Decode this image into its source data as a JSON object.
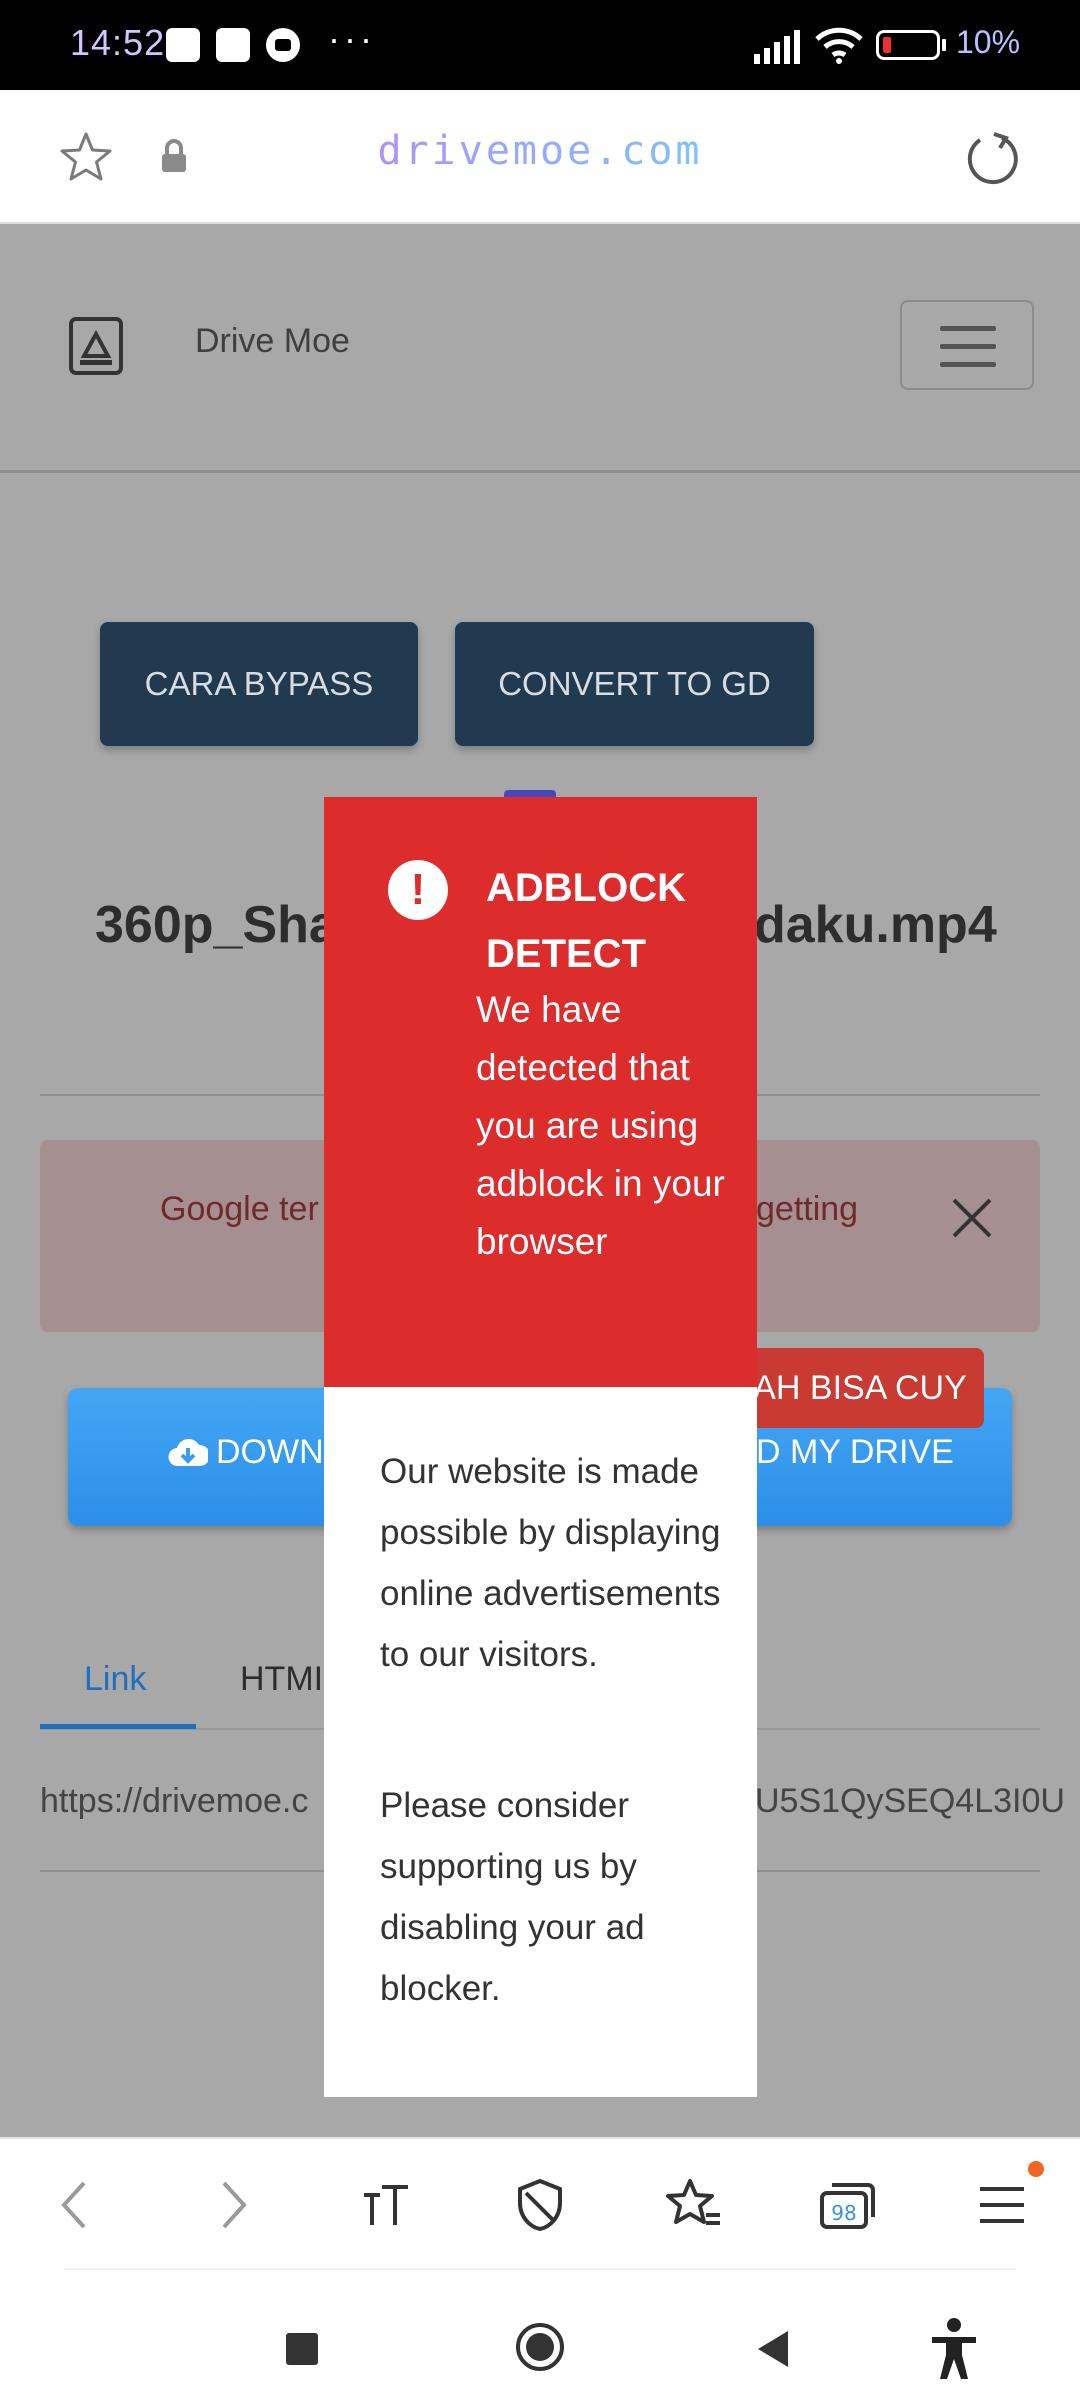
{
  "status_bar": {
    "time": "14:52",
    "more": "···",
    "battery": "10%"
  },
  "browser": {
    "url": "drivemoe.com"
  },
  "site": {
    "brand": "Drive Moe",
    "buttons": {
      "bypass": "CARA BYPASS",
      "convert": "CONVERT TO GD"
    },
    "file_title": "360p_Sha",
    "file_title_tail": "daku.mp4",
    "alert_left": "Google ter",
    "alert_right": "getting",
    "download_left": "DOWN",
    "download_right": "D MY DRIVE",
    "badge": "AH BISA CUY",
    "tabs": {
      "link": "Link",
      "html": "HTMI"
    },
    "link_left": "https://drivemoe.c",
    "link_right": "U5S1QySEQ4L3I0U"
  },
  "modal": {
    "title": "ADBLOCK DETECT",
    "message": "We have detected that you are using adblock in your browser",
    "body_p1": "Our website is made possible by displaying online advertisements to our visitors.",
    "body_p2": "Please consider supporting us by disabling your ad blocker."
  },
  "toolbar": {
    "tabs_count": "98"
  }
}
